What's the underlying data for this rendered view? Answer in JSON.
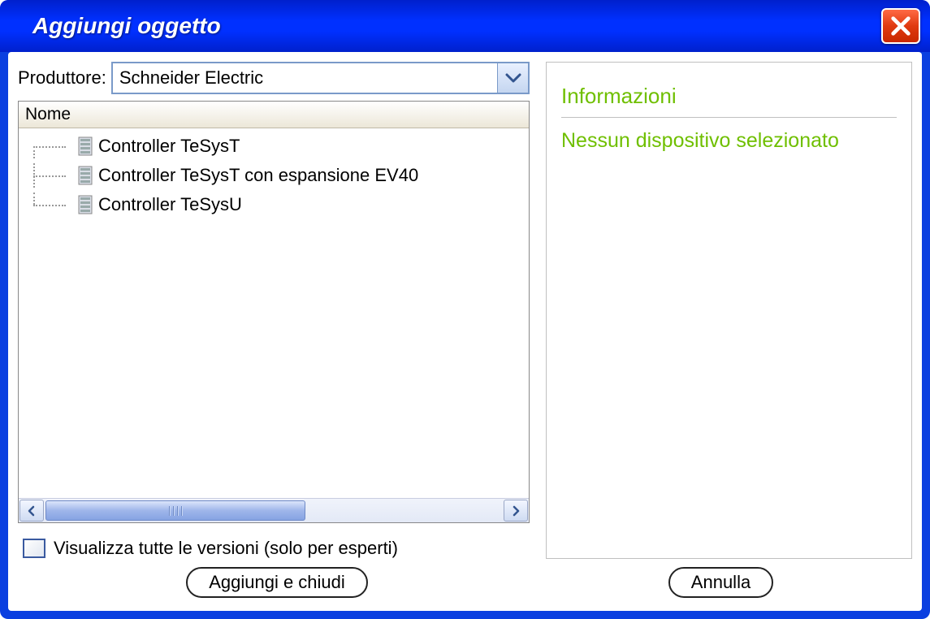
{
  "window": {
    "title": "Aggiungi oggetto"
  },
  "producer": {
    "label": "Produttore:",
    "value": "Schneider Electric"
  },
  "tree": {
    "header": "Nome",
    "items": [
      {
        "label": "Controller TeSysT"
      },
      {
        "label": "Controller TeSysT con espansione EV40"
      },
      {
        "label": "Controller TeSysU"
      }
    ]
  },
  "checkbox": {
    "label": "Visualizza tutte le versioni (solo per esperti)",
    "checked": false
  },
  "info": {
    "heading": "Informazioni",
    "message": "Nessun dispositivo selezionato"
  },
  "buttons": {
    "add_close": "Aggiungi e chiudi",
    "cancel": "Annulla"
  }
}
